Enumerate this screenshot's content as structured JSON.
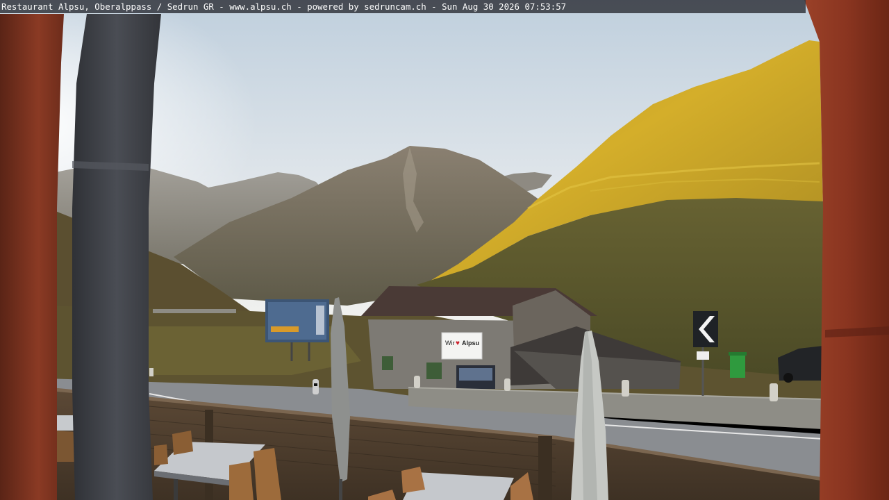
{
  "overlay": {
    "caption": "Restaurant Alpsu, Oberalppass / Sedrun GR - www.alpsu.ch - powered by sedruncam.ch -  Sun Aug 30 2026 07:53:57"
  },
  "hut_sign": {
    "prefix": "Wir",
    "heart": "♥",
    "word": "Alpsu"
  },
  "colors": {
    "sky_top": "#c9d6e2",
    "sky_horizon": "#eef1f2",
    "sunlit_slope": "#c8a321",
    "shaded_slope": "#5b5a2e",
    "far_ridge": "#7c756b",
    "road": "#8f9296",
    "frame_wood": "#8a3a24",
    "pole": "#3d4046",
    "hut_roof": "#4a3a36",
    "hut_wall": "#7d7a74"
  },
  "icons": {
    "direction_sign": "chevron-left-icon",
    "sign_heart": "heart-icon"
  }
}
